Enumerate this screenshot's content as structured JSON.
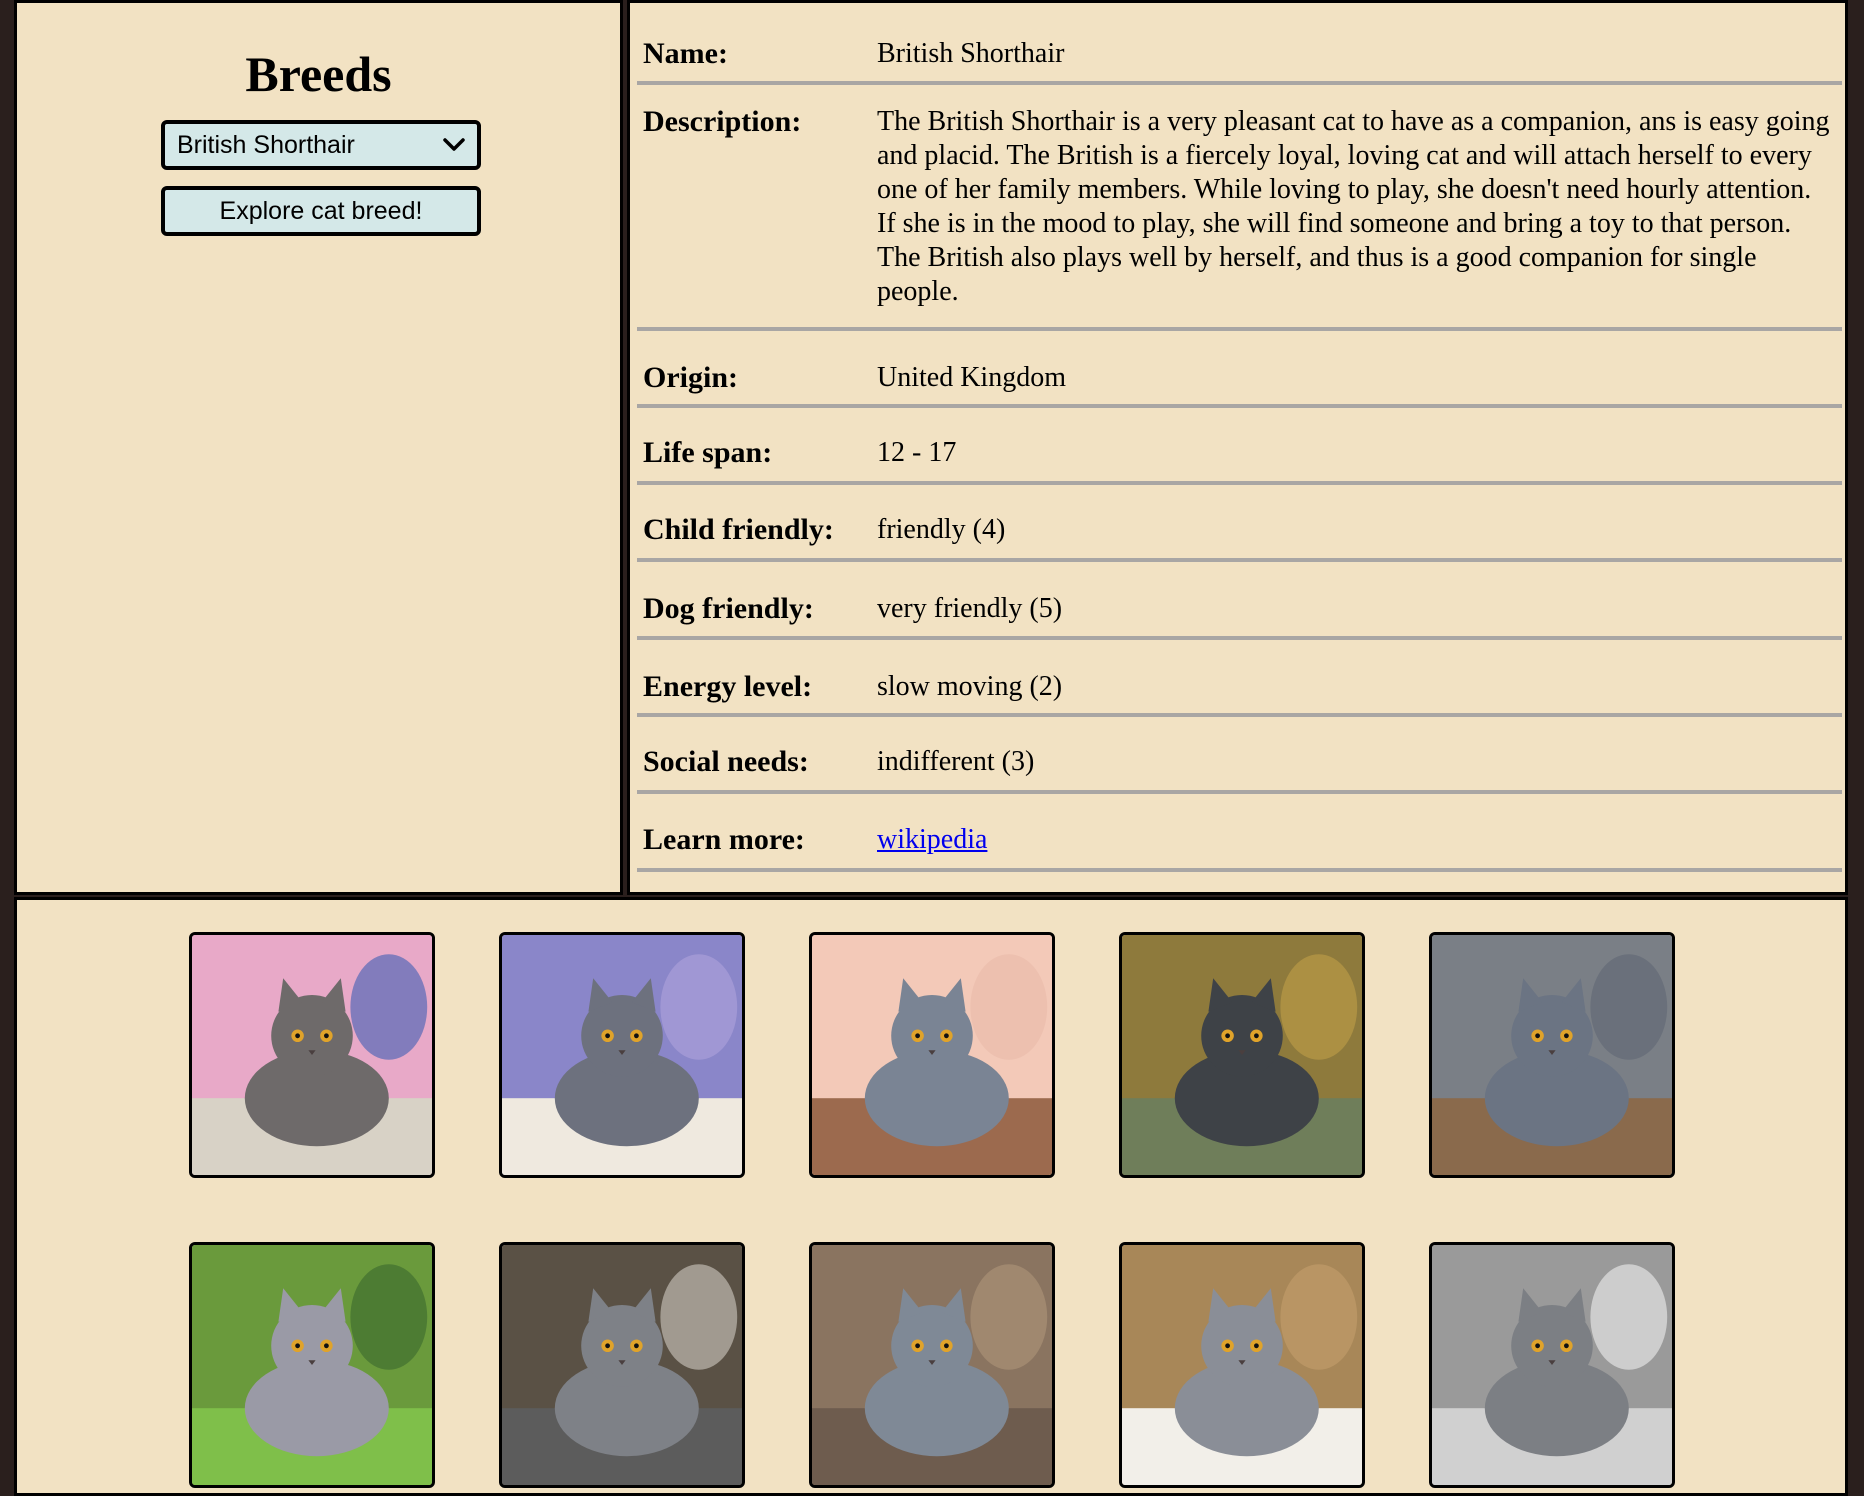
{
  "sidebar": {
    "title": "Breeds",
    "select": {
      "selected": "British Shorthair"
    },
    "explore_button": "Explore cat breed!"
  },
  "details": {
    "rows": [
      {
        "label": "Name:",
        "value": "British Shorthair"
      },
      {
        "label": "Description:",
        "value": "The British Shorthair is a very pleasant cat to have as a companion, ans is easy going and placid. The British is a fiercely loyal, loving cat and will attach herself to every one of her family members. While loving to play, she doesn't need hourly attention. If she is in the mood to play, she will find someone and bring a toy to that person. The British also plays well by herself, and thus is a good companion for single people."
      },
      {
        "label": "Origin:",
        "value": "United Kingdom"
      },
      {
        "label": "Life span:",
        "value": "12 - 17"
      },
      {
        "label": "Child friendly:",
        "value": "friendly (4)"
      },
      {
        "label": "Dog friendly:",
        "value": "very friendly (5)"
      },
      {
        "label": "Energy level:",
        "value": "slow moving (2)"
      },
      {
        "label": "Social needs:",
        "value": "indifferent (3)"
      },
      {
        "label": "Learn more:",
        "value": "wikipedia"
      }
    ]
  },
  "gallery": {
    "images": [
      {
        "bg": "#e8a9c8",
        "floor": "#d8d2c6",
        "cat": "#6e6a6a",
        "accent": "#1c4fb0"
      },
      {
        "bg": "#8a86c9",
        "floor": "#efe9df",
        "cat": "#6d717e",
        "accent": "#b5a7e0"
      },
      {
        "bg": "#f3c9b8",
        "floor": "#9c6a4e",
        "cat": "#7a8494",
        "accent": "#e8b7a5"
      },
      {
        "bg": "#8e7a3c",
        "floor": "#6f7e5a",
        "cat": "#3e4247",
        "accent": "#c9a64a"
      },
      {
        "bg": "#7a7f86",
        "floor": "#8a6a4c",
        "cat": "#6b7483",
        "accent": "#5a6270"
      },
      {
        "bg": "#6a9a3c",
        "floor": "#7fbf4a",
        "cat": "#9a9aa6",
        "accent": "#2f5d2a"
      },
      {
        "bg": "#5a5145",
        "floor": "#5c5c5c",
        "cat": "#7e8187",
        "accent": "#e8e4dc"
      },
      {
        "bg": "#8a7460",
        "floor": "#6e5c4e",
        "cat": "#7f8996",
        "accent": "#b59b7e"
      },
      {
        "bg": "#a88758",
        "floor": "#f2efe9",
        "cat": "#8a8e97",
        "accent": "#c9a370"
      },
      {
        "bg": "#9a9a9a",
        "floor": "#d0d0d0",
        "cat": "#7c7f84",
        "accent": "#ffffff"
      }
    ]
  }
}
